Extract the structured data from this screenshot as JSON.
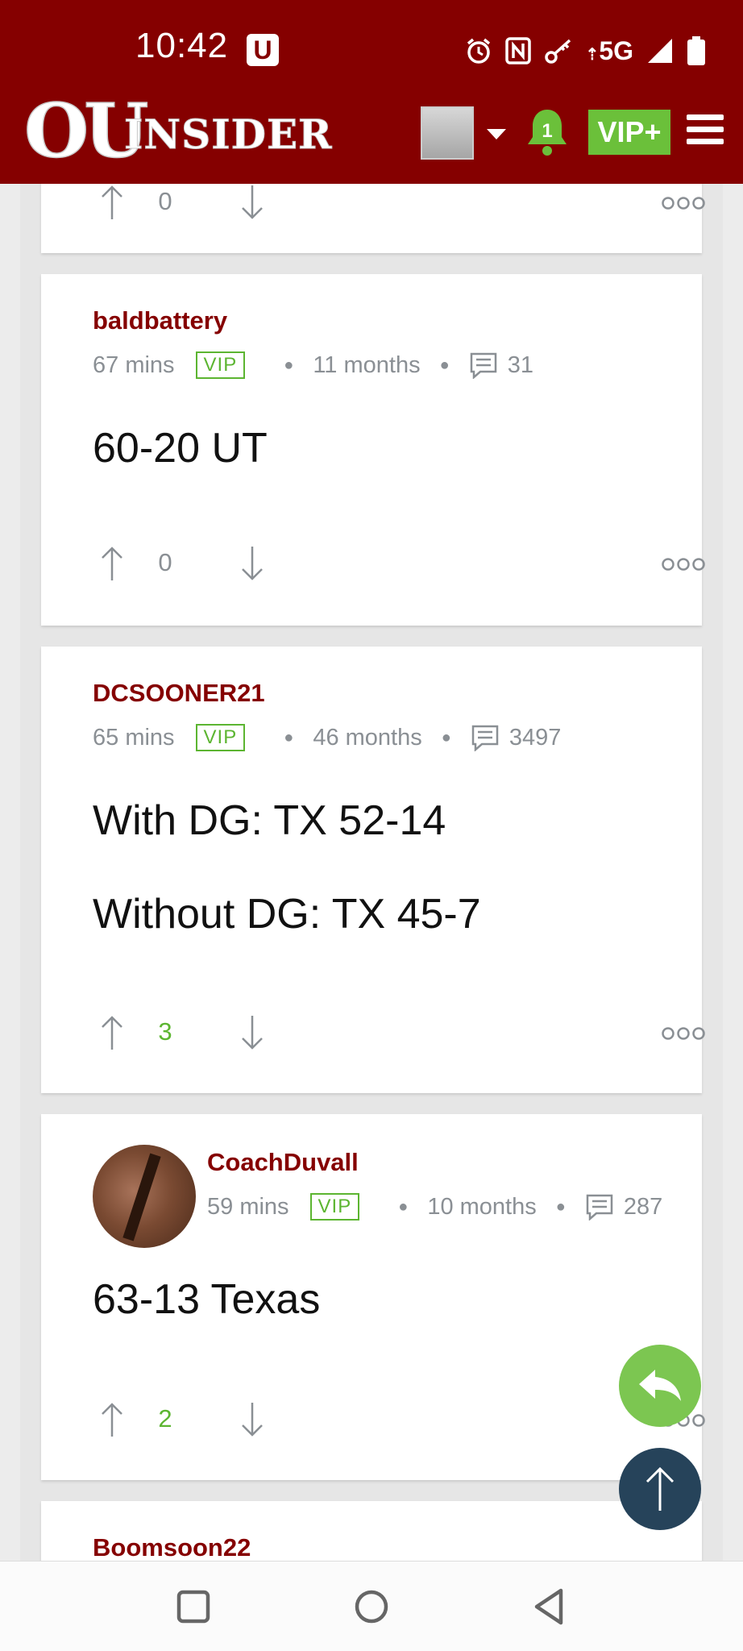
{
  "status_bar": {
    "time": "10:42",
    "notification_badge": "U",
    "network": "5G",
    "icons": [
      "alarm-icon",
      "nfc-icon",
      "key-icon",
      "signal-icon",
      "battery-icon"
    ]
  },
  "header": {
    "logo_text": "OU INSIDER",
    "notification_count": "1",
    "vip_label": "VIP+"
  },
  "posts": [
    {
      "author": "",
      "votes": "0"
    },
    {
      "author": "baldbattery",
      "time_ago": "67 mins",
      "badge": "VIP",
      "member_for": "11 months",
      "post_count": "31",
      "lines": [
        "60-20 UT"
      ],
      "votes": "0"
    },
    {
      "author": "DCSOONER21",
      "time_ago": "65 mins",
      "badge": "VIP",
      "member_for": "46 months",
      "post_count": "3497",
      "lines": [
        "With DG: TX 52-14",
        "Without DG: TX 45-7"
      ],
      "votes": "3"
    },
    {
      "author": "CoachDuvall",
      "time_ago": "59 mins",
      "badge": "VIP",
      "member_for": "10 months",
      "post_count": "287",
      "lines": [
        "63-13 Texas"
      ],
      "votes": "2"
    },
    {
      "author": "Boomsoon22"
    }
  ],
  "colors": {
    "brand": "#850000",
    "accent_green": "#5cb531",
    "fab_top": "#26435a"
  }
}
